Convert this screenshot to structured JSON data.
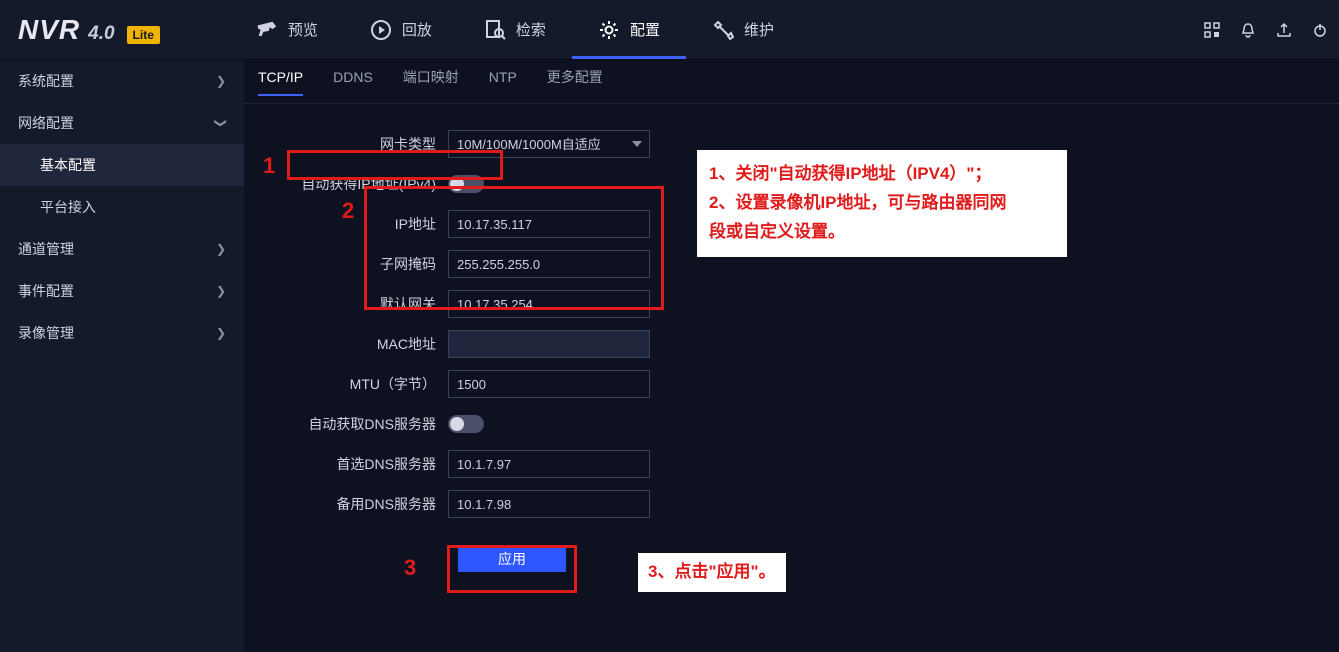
{
  "brand": {
    "name": "NVR",
    "version": "4.0",
    "edition": "Lite"
  },
  "nav": {
    "preview": "预览",
    "playback": "回放",
    "search": "检索",
    "config": "配置",
    "maintain": "维护"
  },
  "sidebar": {
    "system": "系统配置",
    "network": "网络配置",
    "basic": "基本配置",
    "platform": "平台接入",
    "channel": "通道管理",
    "event": "事件配置",
    "record": "录像管理"
  },
  "subtabs": {
    "tcpip": "TCP/IP",
    "ddns": "DDNS",
    "port": "端口映射",
    "ntp": "NTP",
    "more": "更多配置"
  },
  "form": {
    "nic_type_label": "网卡类型",
    "nic_type_value": "10M/100M/1000M自适应",
    "auto_ipv4_label": "自动获得IP地址(IPv4)",
    "ip_label": "IP地址",
    "ip_value": "10.17.35.117",
    "mask_label": "子网掩码",
    "mask_value": "255.255.255.0",
    "gw_label": "默认网关",
    "gw_value": "10.17.35.254",
    "mac_label": "MAC地址",
    "mtu_label": "MTU（字节）",
    "mtu_value": "1500",
    "auto_dns_label": "自动获取DNS服务器",
    "dns1_label": "首选DNS服务器",
    "dns1_value": "10.1.7.97",
    "dns2_label": "备用DNS服务器",
    "dns2_value": "10.1.7.98",
    "apply": "应用"
  },
  "annot": {
    "n1": "1",
    "n2": "2",
    "n3": "3",
    "note_a_line1": "1、关闭\"自动获得IP地址（IPV4）\"；",
    "note_a_line2": "2、设置录像机IP地址，可与路由器同网",
    "note_a_line3": "段或自定义设置。",
    "note_b": "3、点击\"应用\"。"
  }
}
